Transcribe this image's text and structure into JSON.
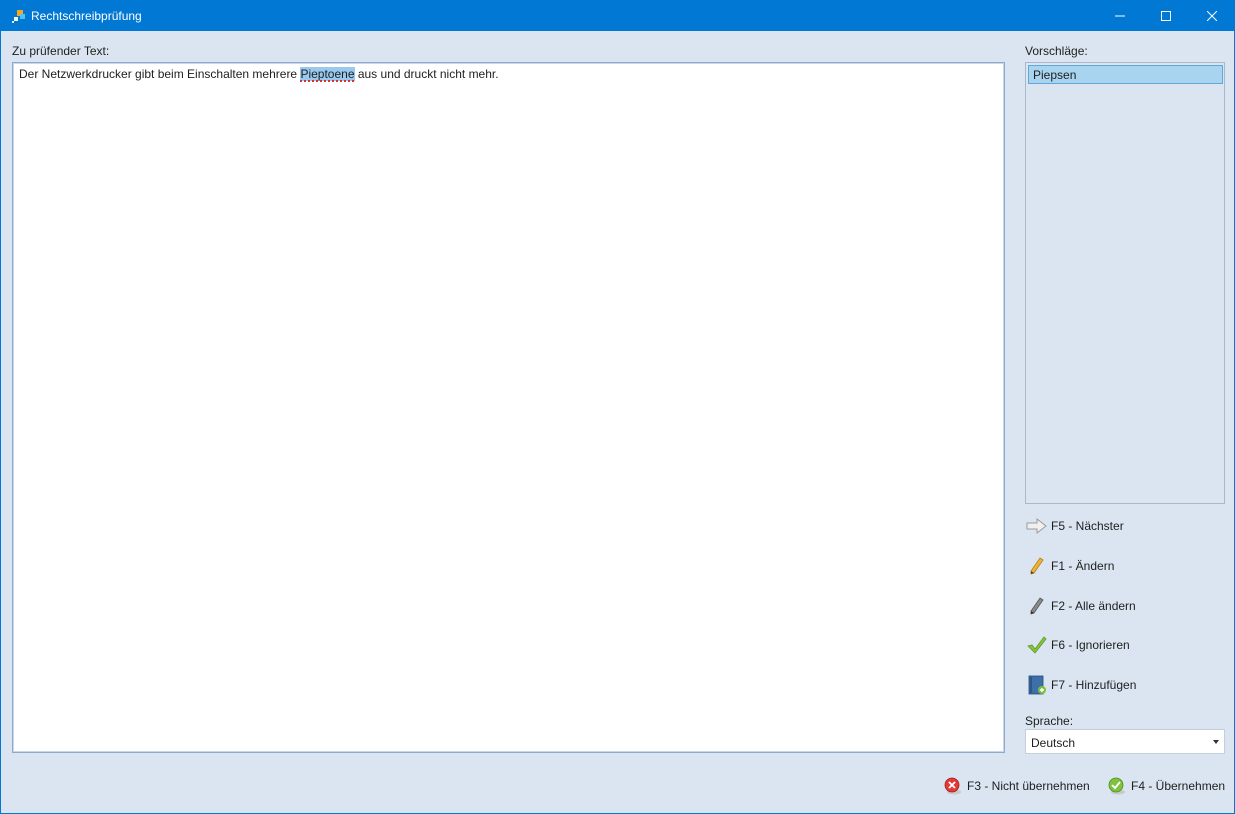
{
  "window": {
    "title": "Rechtschreibprüfung",
    "icon": "app-icon"
  },
  "text_panel": {
    "label": "Zu prüfender Text:",
    "before": "Der Netzwerkdrucker gibt beim Einschalten mehrere ",
    "misspelled": "Pieptoene",
    "after": " aus und druckt nicht mehr."
  },
  "suggestions": {
    "label": "Vorschläge:",
    "items": [
      "Piepsen"
    ]
  },
  "actions": [
    {
      "key": "next",
      "label": "F5 - Nächster",
      "icon": "arrow-right-icon"
    },
    {
      "key": "change",
      "label": "F1 - Ändern",
      "icon": "pencil-icon"
    },
    {
      "key": "change_all",
      "label": "F2 - Alle ändern",
      "icon": "pencil-gray-icon"
    },
    {
      "key": "ignore",
      "label": "F6 - Ignorieren",
      "icon": "checkmark-icon"
    },
    {
      "key": "add",
      "label": "F7 - Hinzufügen",
      "icon": "dictionary-add-icon"
    }
  ],
  "language": {
    "label": "Sprache:",
    "value": "Deutsch"
  },
  "footer": {
    "reject_label": "F3 - Nicht übernehmen",
    "accept_label": "F4 - Übernehmen"
  },
  "colors": {
    "titlebar": "#0078d4",
    "background": "#dbe5f1",
    "selection": "#a8d4ef"
  }
}
